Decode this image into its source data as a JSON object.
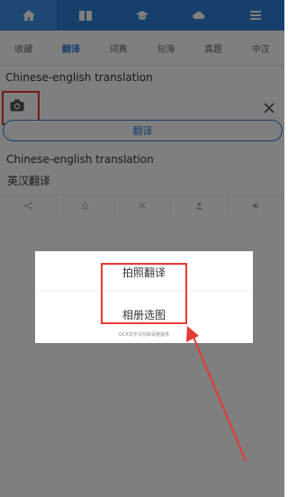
{
  "top_tabs": [
    {
      "icon": "home-icon"
    },
    {
      "icon": "book-icon"
    },
    {
      "icon": "graduation-cap-icon"
    },
    {
      "icon": "cloud-icon"
    },
    {
      "icon": "list-icon"
    }
  ],
  "sub_tabs": [
    "收藏",
    "翻译",
    "词典",
    "句海",
    "真题",
    "中汉"
  ],
  "input": {
    "text": "Chinese-english translation"
  },
  "translate_button": "翻译",
  "result": {
    "english": "Chinese-english translation",
    "chinese": "英汉翻译"
  },
  "result_toolbar": [
    "share-icon",
    "star-icon",
    "close-icon",
    "person-icon",
    "speaker-icon"
  ],
  "dialog": {
    "option_camera": "拍照翻译",
    "option_album": "相册选图",
    "footer": "OCR文字识别由百度提供"
  },
  "colors": {
    "primary": "#2f7fd6",
    "highlight": "#e53935"
  }
}
